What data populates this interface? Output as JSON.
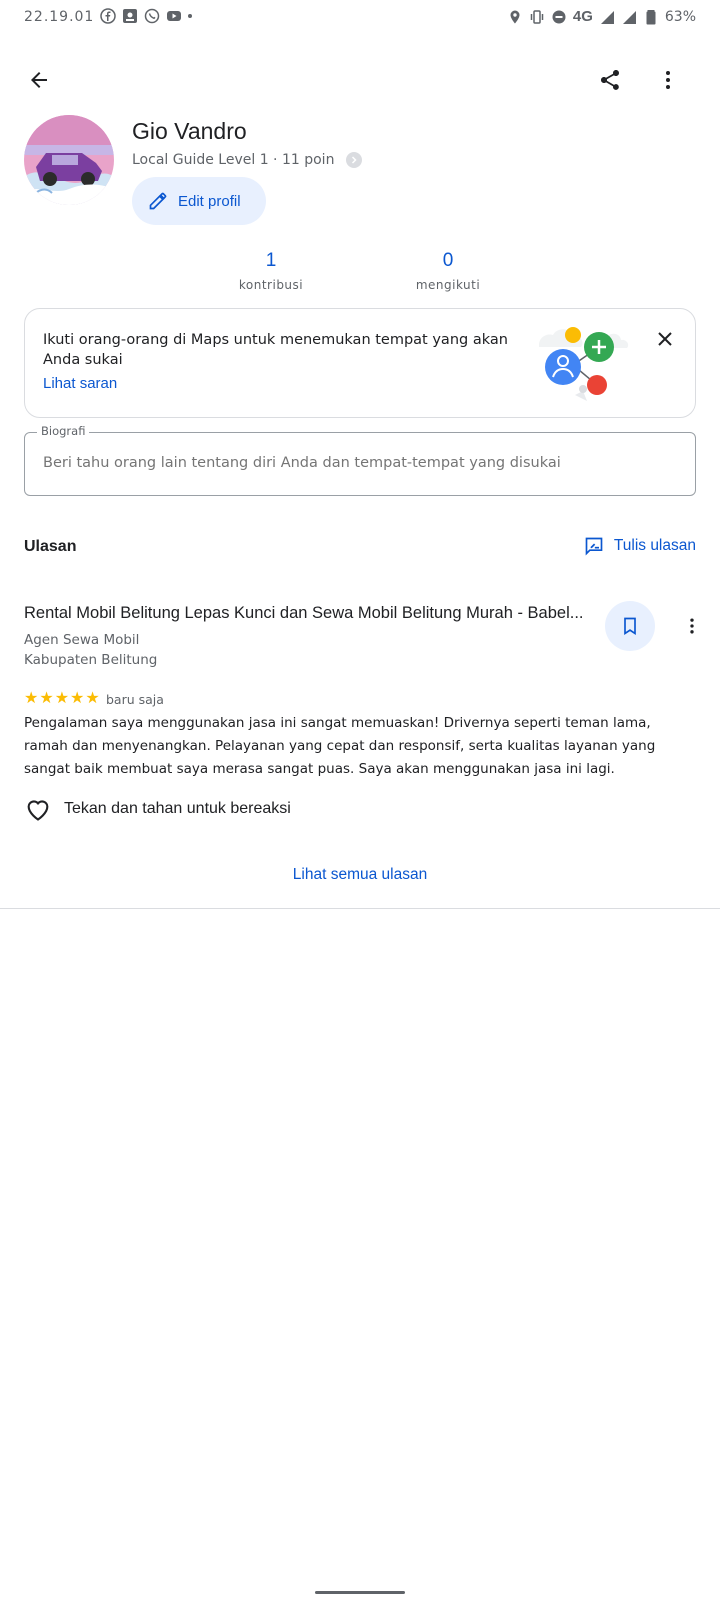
{
  "status_bar": {
    "time": "22.19.01",
    "network": "4G",
    "battery": "63%"
  },
  "profile": {
    "name": "Gio Vandro",
    "level": "Local Guide Level 1 · 11 poin",
    "edit_label": "Edit profil"
  },
  "stats": [
    {
      "value": "1",
      "label": "kontribusi"
    },
    {
      "value": "0",
      "label": "mengikuti"
    }
  ],
  "suggest_card": {
    "text": "Ikuti orang-orang di Maps untuk menemukan tempat yang akan Anda sukai",
    "link": "Lihat saran"
  },
  "bio": {
    "label": "Biografi",
    "placeholder": "Beri tahu orang lain tentang diri Anda dan tempat-tempat yang disukai"
  },
  "reviews": {
    "title": "Ulasan",
    "write_label": "Tulis ulasan",
    "see_all": "Lihat semua ulasan",
    "items": [
      {
        "place": "Rental Mobil Belitung Lepas Kunci dan Sewa Mobil Belitung Murah - Babel...",
        "category": "Agen Sewa Mobil",
        "location": "Kabupaten Belitung",
        "rating": 5,
        "time": "baru saja",
        "text": "Pengalaman saya menggunakan jasa ini sangat memuaskan! Drivernya seperti teman lama, ramah dan menyenangkan. Pelayanan yang cepat dan responsif, serta kualitas layanan yang sangat baik membuat saya merasa sangat puas. Saya akan menggunakan jasa ini lagi.",
        "react_label": "Tekan dan tahan untuk bereaksi"
      }
    ]
  },
  "colors": {
    "accent": "#0b57d0",
    "accent_bg": "#e8f0fe",
    "star": "#fbbc04"
  },
  "icons": [
    "back-arrow-icon",
    "share-icon",
    "more-vert-icon",
    "pencil-icon",
    "close-icon",
    "rate-review-icon",
    "bookmark-icon",
    "heart-outline-icon"
  ]
}
